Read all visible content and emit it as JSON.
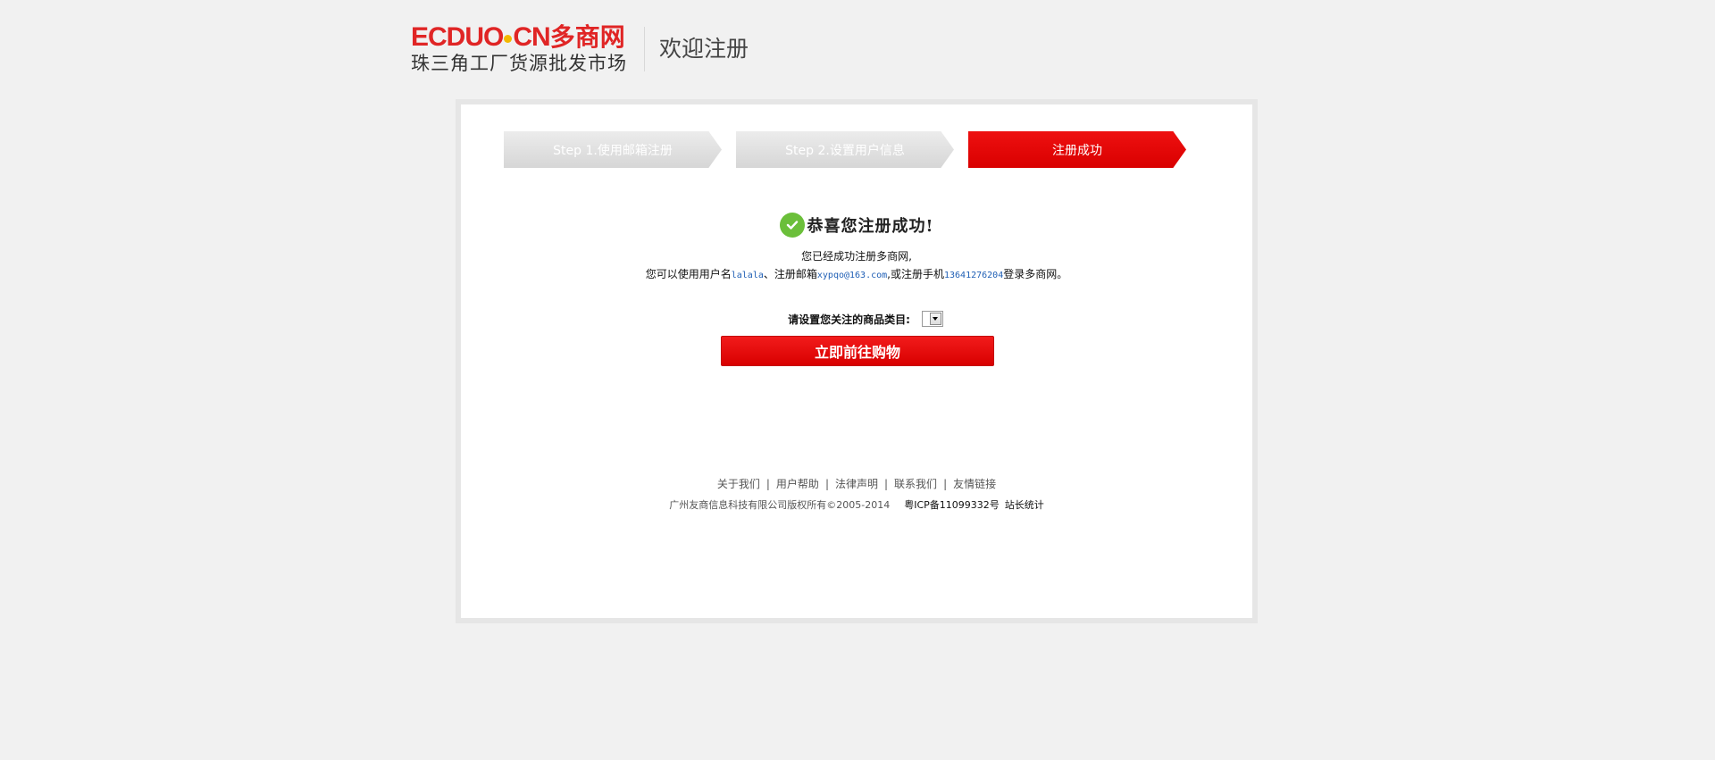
{
  "header": {
    "logo_latin": "ECDUOCN",
    "logo_latin_a": "ECDUO",
    "logo_latin_b": "CN",
    "logo_cn": "多商网",
    "logo_tagline": "珠三角工厂货源批发市场",
    "title": "欢迎注册"
  },
  "steps": [
    {
      "label": "Step 1.使用邮箱注册",
      "state": "completed"
    },
    {
      "label": "Step 2.设置用户信息",
      "state": "completed"
    },
    {
      "label": "注册成功",
      "state": "active"
    }
  ],
  "success": {
    "title": "恭喜您注册成功!",
    "line1": "您已经成功注册多商网,",
    "line2_prefix": "您可以使用用户名",
    "username": "lalala",
    "line2_mid1": "、注册邮箱",
    "email": "xypqo@163.com",
    "line2_mid2": ",或注册手机",
    "phone": "13641276204",
    "line2_suffix": "登录多商网。"
  },
  "category": {
    "label": "请设置您关注的商品类目:",
    "selected": ""
  },
  "shop_button_label": "立即前往购物",
  "footer": {
    "links": [
      "关于我们",
      "用户帮助",
      "法律声明",
      "联系我们",
      "友情链接"
    ],
    "copyright": "广州友商信息科技有限公司版权所有©2005-2014",
    "icp": "粤ICP备11099332号",
    "stats_link": "站长统计"
  },
  "colors": {
    "brand_red": "#e02525",
    "active_step": "#e00000",
    "check_green": "#6bbf3a",
    "highlight_blue": "#1f5fb5",
    "background": "#f1f1f1"
  }
}
